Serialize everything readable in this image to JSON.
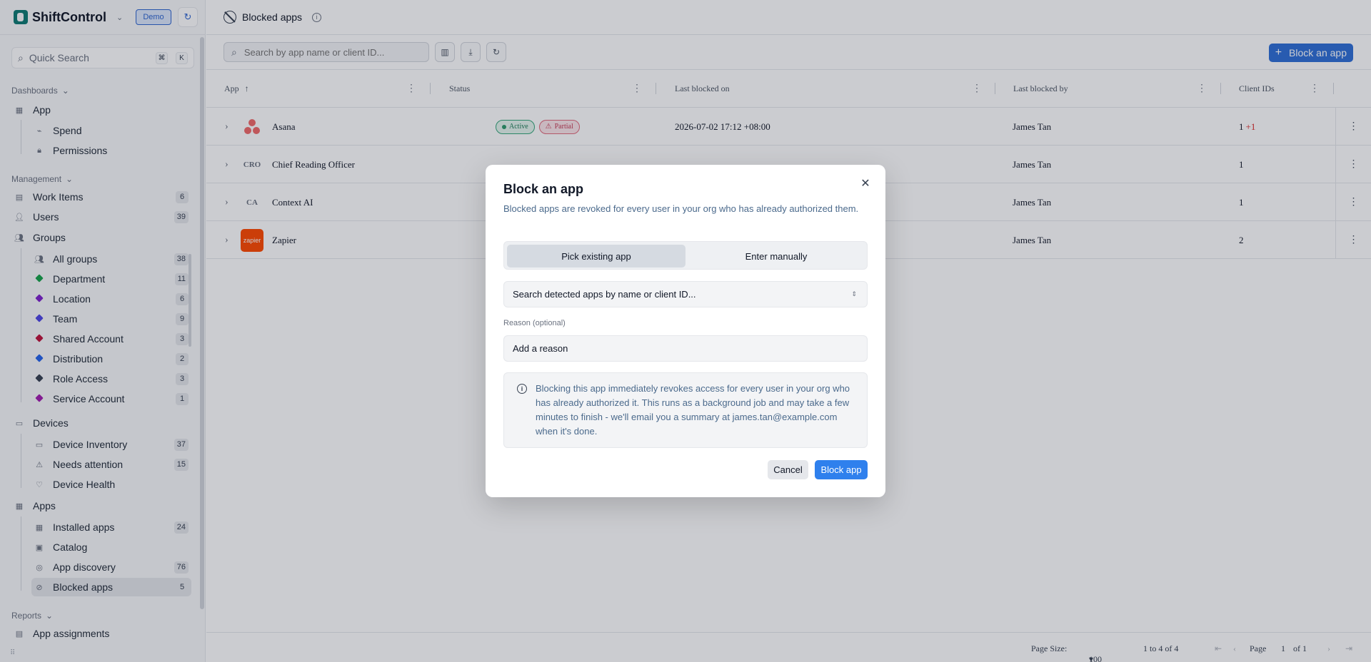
{
  "brand": {
    "name": "ShiftControl",
    "env_badge": "Demo"
  },
  "sidebar": {
    "quick_search": {
      "label": "Quick Search",
      "kbd": [
        "⌘",
        "K"
      ]
    },
    "dashboards": {
      "label": "Dashboards",
      "app": "App",
      "items": [
        {
          "label": "Spend"
        },
        {
          "label": "Permissions"
        }
      ]
    },
    "management": {
      "label": "Management",
      "work_items": {
        "label": "Work Items",
        "count": "6"
      },
      "users": {
        "label": "Users",
        "count": "39"
      },
      "groups": {
        "label": "Groups",
        "items": [
          {
            "label": "All groups",
            "count": "38"
          },
          {
            "label": "Department",
            "count": "11",
            "color": "#16a34a"
          },
          {
            "label": "Location",
            "count": "6",
            "color": "#7e22ce"
          },
          {
            "label": "Team",
            "count": "9",
            "color": "#4f46e5"
          },
          {
            "label": "Shared Account",
            "count": "3",
            "color": "#be123c"
          },
          {
            "label": "Distribution",
            "count": "2",
            "color": "#2563eb"
          },
          {
            "label": "Role Access",
            "count": "3",
            "color": "#374151"
          },
          {
            "label": "Service Account",
            "count": "1",
            "color": "#a21caf"
          }
        ]
      },
      "devices": {
        "label": "Devices",
        "items": [
          {
            "label": "Device Inventory",
            "count": "37"
          },
          {
            "label": "Needs attention",
            "count": "15"
          },
          {
            "label": "Device Health",
            "count": ""
          }
        ]
      },
      "apps": {
        "label": "Apps",
        "items": [
          {
            "label": "Installed apps",
            "count": "24"
          },
          {
            "label": "Catalog",
            "count": ""
          },
          {
            "label": "App discovery",
            "count": "76"
          },
          {
            "label": "Blocked apps",
            "count": "5"
          }
        ]
      }
    },
    "reports": {
      "label": "Reports",
      "items": [
        {
          "label": "App assignments"
        }
      ]
    }
  },
  "page": {
    "title": "Blocked apps",
    "info": "i"
  },
  "toolbar": {
    "search_placeholder": "Search by app name or client ID...",
    "block_button": "Block an app",
    "plus": "+"
  },
  "table": {
    "columns": [
      "App",
      "Status",
      "Last blocked on",
      "Last blocked by",
      "Client IDs"
    ],
    "sort_arrow": "↑",
    "rows": [
      {
        "app": "Asana",
        "logo": "",
        "statuses": [
          "Active",
          "Partial"
        ],
        "last_blocked_on": "2026-07-02 17:12 +08:00",
        "last_blocked_by": "James Tan",
        "client_ids": "1",
        "extra": "+1"
      },
      {
        "app": "Chief Reading Officer",
        "logo": "CRO",
        "statuses": [],
        "last_blocked_on": "",
        "last_blocked_by": "James Tan",
        "client_ids": "1",
        "extra": ""
      },
      {
        "app": "Context AI",
        "logo": "CA",
        "statuses": [],
        "last_blocked_on": "",
        "last_blocked_by": "James Tan",
        "client_ids": "1",
        "extra": ""
      },
      {
        "app": "Zapier",
        "logo": "zapier",
        "statuses": [],
        "last_blocked_on": "",
        "last_blocked_by": "James Tan",
        "client_ids": "2",
        "extra": ""
      }
    ]
  },
  "pager": {
    "page_size_label": "Page Size:",
    "page_size": "100",
    "range": "1 to 4 of 4",
    "page_label": "Page",
    "page": "1",
    "of": "of 1"
  },
  "modal": {
    "title": "Block an app",
    "subtitle": "Blocked apps are revoked for every user in your org who has already authorized them.",
    "tab_pick": "Pick existing app",
    "tab_manual": "Enter manually",
    "combo_placeholder": "Search detected apps by name or client ID...",
    "reason_label": "Reason (optional)",
    "reason_placeholder": "Add a reason",
    "notice": "Blocking this app immediately revokes access for every user in your org who has already authorized it. This runs as a background job and may take a few minutes to finish - we'll email you a summary at james.tan@example.com when it's done.",
    "cancel": "Cancel",
    "confirm": "Block app"
  },
  "colors": {
    "accent": "#2f6fd6",
    "primary_button": "#2f80ed",
    "brand": "#0e7a73"
  }
}
